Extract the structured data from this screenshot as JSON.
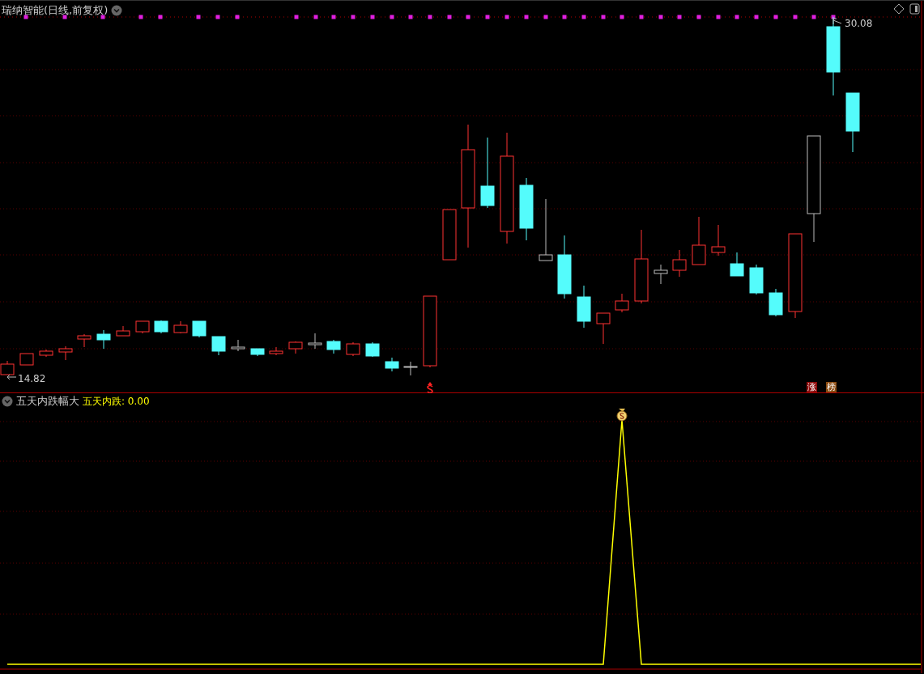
{
  "main_chart": {
    "title": "瑞纳智能(日线,前复权)",
    "high_label": "30.08",
    "low_label": "14.82",
    "badges": [
      {
        "text": "涨",
        "color": "#8b0a0a"
      },
      {
        "text": "榜",
        "color": "#8a4a10"
      }
    ]
  },
  "indicator": {
    "name": "五天内跌幅大",
    "value_label": "五天内跌: 0.00"
  }
}
